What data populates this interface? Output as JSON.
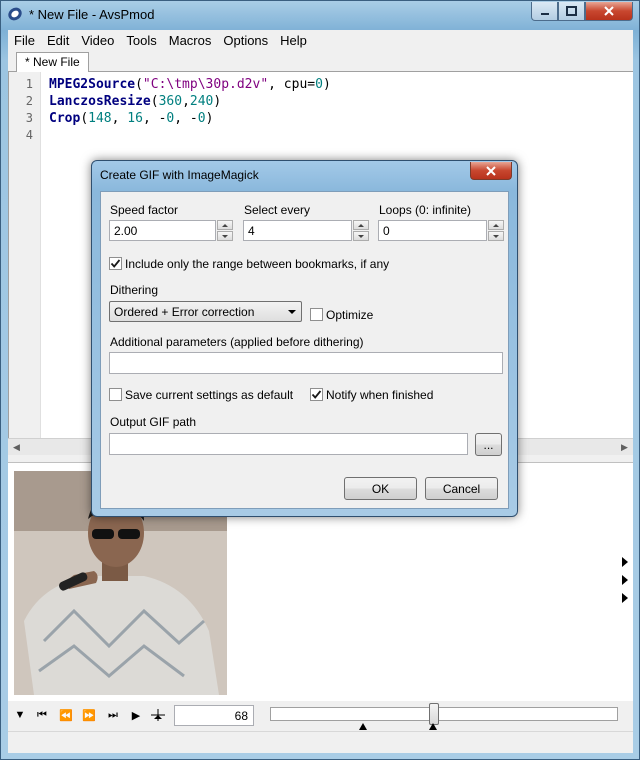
{
  "window": {
    "title": "* New File - AvsPmod"
  },
  "menu": [
    "File",
    "Edit",
    "Video",
    "Tools",
    "Macros",
    "Options",
    "Help"
  ],
  "tab": {
    "label": "* New File"
  },
  "editor": {
    "line_numbers": [
      "1",
      "2",
      "3",
      "4"
    ],
    "lines": [
      [
        {
          "t": "MPEG2Source",
          "c": "fn"
        },
        {
          "t": "(",
          "c": "punc"
        },
        {
          "t": "\"C:\\tmp\\30p.d2v\"",
          "c": "str"
        },
        {
          "t": ", cpu=",
          "c": "punc"
        },
        {
          "t": "0",
          "c": "num"
        },
        {
          "t": ")",
          "c": "punc"
        }
      ],
      [
        {
          "t": "LanczosResize",
          "c": "fn"
        },
        {
          "t": "(",
          "c": "punc"
        },
        {
          "t": "360",
          "c": "num"
        },
        {
          "t": ",",
          "c": "punc"
        },
        {
          "t": "240",
          "c": "num"
        },
        {
          "t": ")",
          "c": "punc"
        }
      ],
      [
        {
          "t": "Crop",
          "c": "fn"
        },
        {
          "t": "(",
          "c": "punc"
        },
        {
          "t": "148",
          "c": "num"
        },
        {
          "t": ", ",
          "c": "punc"
        },
        {
          "t": "16",
          "c": "num"
        },
        {
          "t": ", -",
          "c": "punc"
        },
        {
          "t": "0",
          "c": "num"
        },
        {
          "t": ", -",
          "c": "punc"
        },
        {
          "t": "0",
          "c": "num"
        },
        {
          "t": ")",
          "c": "punc"
        }
      ],
      []
    ]
  },
  "toolbar": {
    "frame_value": "68",
    "slider_fraction": 0.47
  },
  "dialog": {
    "title": "Create GIF with ImageMagick",
    "speed_factor": {
      "label": "Speed factor",
      "value": "2.00"
    },
    "select_every": {
      "label": "Select every",
      "value": "4"
    },
    "loops": {
      "label": "Loops (0: infinite)",
      "value": "0"
    },
    "bookmark_range": {
      "label": "Include only the range between bookmarks, if any",
      "checked": true
    },
    "dithering": {
      "label": "Dithering",
      "value": "Ordered + Error correction"
    },
    "optimize": {
      "label": "Optimize",
      "checked": false
    },
    "additional_params": {
      "label": "Additional parameters (applied before dithering)",
      "value": ""
    },
    "save_default": {
      "label": "Save current settings as default",
      "checked": false
    },
    "notify": {
      "label": "Notify when finished",
      "checked": true
    },
    "output_path": {
      "label": "Output GIF path",
      "value": ""
    },
    "browse_label": "...",
    "ok_label": "OK",
    "cancel_label": "Cancel"
  }
}
